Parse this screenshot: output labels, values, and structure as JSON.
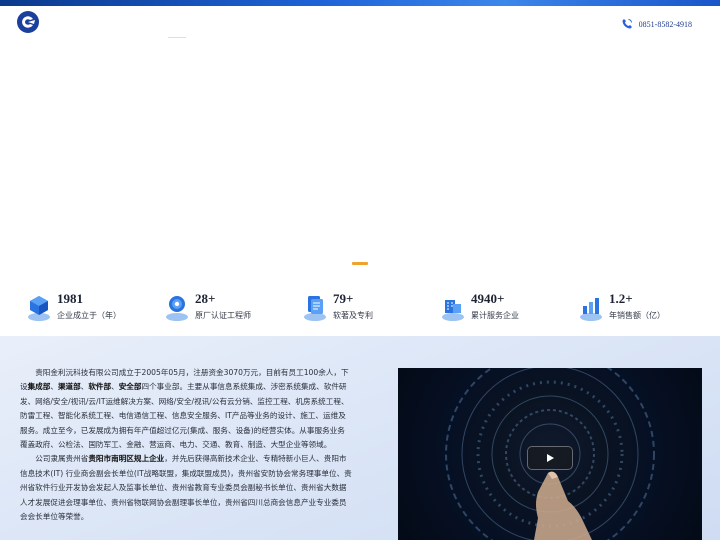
{
  "header": {
    "logo": "company-logo",
    "phone_icon": "phone-icon",
    "phone": "0851-8582-4918"
  },
  "hero": {
    "slider_indicator_color": "#f0a22b"
  },
  "stats": [
    {
      "value": "1981",
      "label": "企业成立于（年）",
      "icon": "cube-stack-icon"
    },
    {
      "value": "28+",
      "label": "原厂认证工程师",
      "icon": "engineer-badge-icon"
    },
    {
      "value": "79+",
      "label": "软著及专利",
      "icon": "document-patent-icon"
    },
    {
      "value": "4940+",
      "label": "累计服务企业",
      "icon": "enterprise-service-icon"
    },
    {
      "value": "1.2+",
      "label": "年销售额（亿）",
      "icon": "sales-chart-icon"
    }
  ],
  "about": {
    "p1_a": "贵阳金利沅科技有限公司成立于2005年05月，注册资金3070万元，目前有员工100余人，下设",
    "p1_b1": "集成部",
    "p1_s1": "、",
    "p1_b2": "渠道部",
    "p1_s2": "、",
    "p1_b3": "软件部",
    "p1_s3": "、",
    "p1_b4": "安全部",
    "p1_c": "四个事业部。主要从事信息系统集成、涉密系统集成、软件研发、网络/安全/视讯/云/IT运维解决方案、网络/安全/视讯/公有云分销、监控工程、机房系统工程、防雷工程、智能化系统工程、电信通信工程、信息安全服务、IT产品等业务的设计、施工、运维及服务。成立至今，已发展成为拥有年产值超过亿元(集成、服务、设备)的经营实体。从事服务业务覆盖政府、公检法、国防军工、金融、营运商、电力、交通、教育、制造、大型企业等领域。",
    "p2_a": "公司隶属贵州省",
    "p2_b": "贵阳市南明区规上企业",
    "p2_c": "，并先后获得高新技术企业、专精特新小巨人、贵阳市信息技术(IT) 行业商会副会长单位(IT战略联盟，集成联盟成员)，贵州省安防协会常务理事单位、贵州省软件行业开发协会发起人及监事长单位、贵州省教育专业委员会副秘书长单位、贵州省大数据人才发展促进会理事单位、贵州省物联网协会副理事长单位，贵州省四川总商会信息产业专业委员会会长单位等荣誉。"
  },
  "video": {
    "play_icon": "play-icon"
  }
}
